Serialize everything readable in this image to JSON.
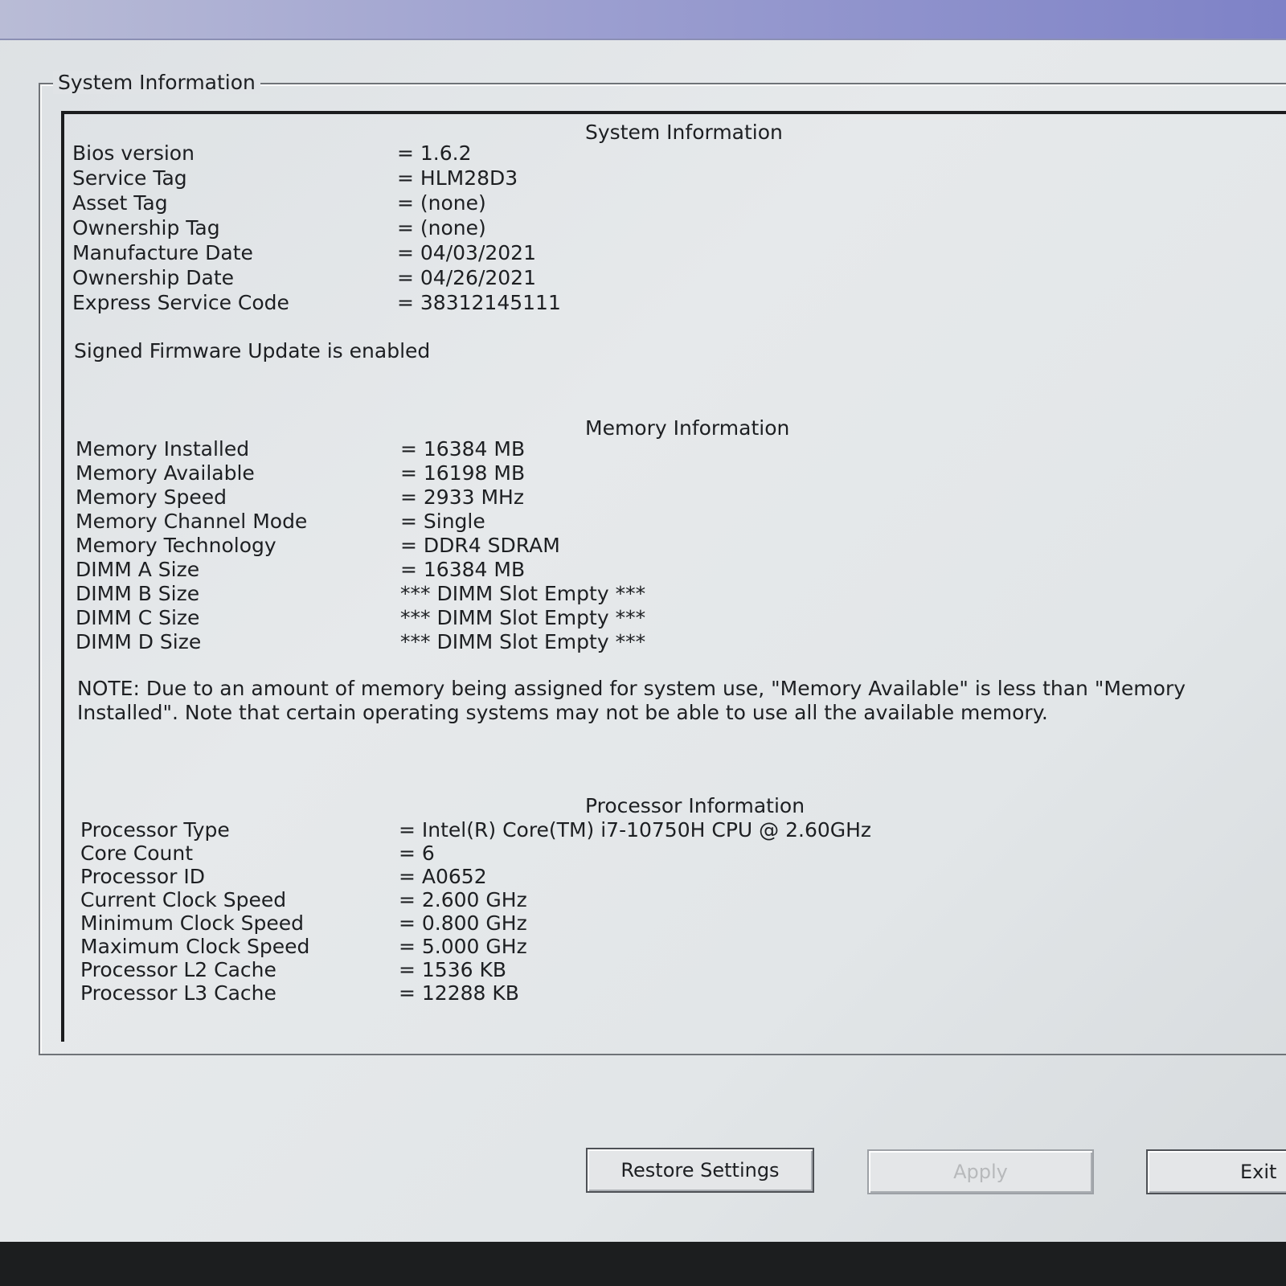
{
  "groupbox": {
    "label": "System Information"
  },
  "system": {
    "heading": "System Information",
    "rows": [
      {
        "label": "Bios version",
        "value": "= 1.6.2"
      },
      {
        "label": "Service Tag",
        "value": "= HLM28D3"
      },
      {
        "label": "Asset Tag",
        "value": "= (none)"
      },
      {
        "label": "Ownership Tag",
        "value": "= (none)"
      },
      {
        "label": "Manufacture Date",
        "value": "= 04/03/2021"
      },
      {
        "label": "Ownership Date",
        "value": "= 04/26/2021"
      },
      {
        "label": "Express Service Code",
        "value": "= 38312145111"
      }
    ],
    "firmware_note": "Signed Firmware Update is enabled"
  },
  "memory": {
    "heading": "Memory Information",
    "rows": [
      {
        "label": "Memory Installed",
        "value": "= 16384 MB"
      },
      {
        "label": "Memory Available",
        "value": "= 16198 MB"
      },
      {
        "label": "Memory Speed",
        "value": "= 2933 MHz"
      },
      {
        "label": "Memory Channel Mode",
        "value": "= Single"
      },
      {
        "label": "Memory Technology",
        "value": "= DDR4 SDRAM"
      },
      {
        "label": "DIMM A Size",
        "value": "= 16384 MB"
      },
      {
        "label": "DIMM B Size",
        "value": "*** DIMM Slot Empty ***"
      },
      {
        "label": "DIMM C Size",
        "value": "*** DIMM Slot Empty ***"
      },
      {
        "label": "DIMM D Size",
        "value": "*** DIMM Slot Empty ***"
      }
    ],
    "note": "NOTE: Due to an amount of memory being assigned for system use, \"Memory Available\" is less than \"Memory Installed\". Note that certain operating systems may not be able to use all the available memory."
  },
  "processor": {
    "heading": "Processor Information",
    "rows": [
      {
        "label": "Processor Type",
        "value": "= Intel(R) Core(TM) i7-10750H CPU @ 2.60GHz"
      },
      {
        "label": "Core Count",
        "value": "= 6"
      },
      {
        "label": "Processor ID",
        "value": "= A0652"
      },
      {
        "label": "Current Clock Speed",
        "value": "= 2.600 GHz"
      },
      {
        "label": "Minimum Clock Speed",
        "value": "= 0.800 GHz"
      },
      {
        "label": "Maximum Clock Speed",
        "value": "= 5.000 GHz"
      },
      {
        "label": "Processor L2 Cache",
        "value": "= 1536 KB"
      },
      {
        "label": "Processor L3 Cache",
        "value": "= 12288 KB"
      }
    ]
  },
  "buttons": {
    "restore": "Restore Settings",
    "apply": "Apply",
    "exit": "Exit"
  }
}
